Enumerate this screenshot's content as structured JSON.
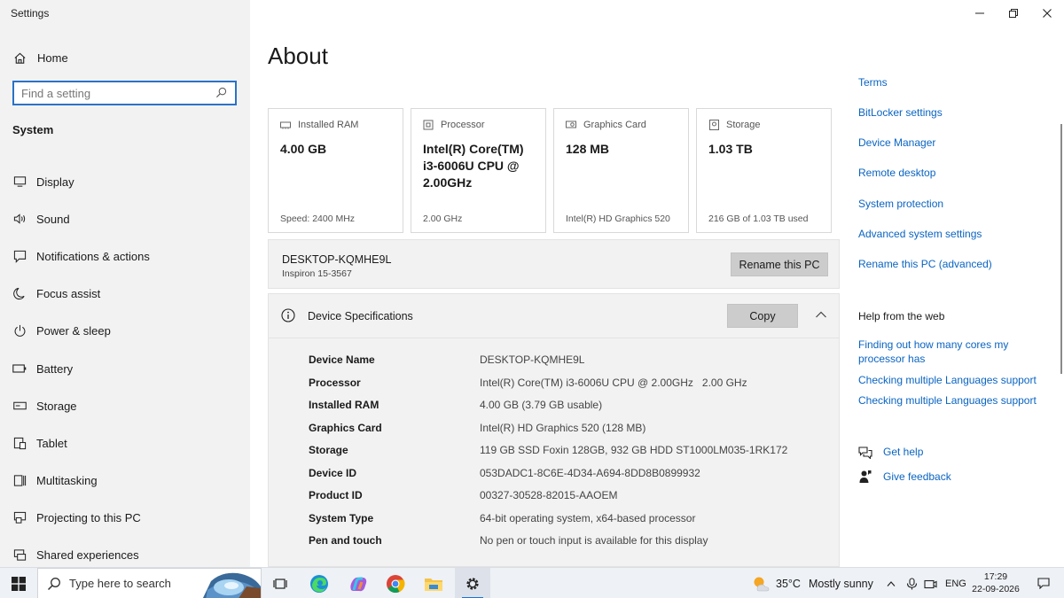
{
  "window": {
    "title": "Settings"
  },
  "sidebar": {
    "home_label": "Home",
    "search_placeholder": "Find a setting",
    "section_title": "System",
    "items": [
      {
        "label": "Display",
        "icon": "monitor-icon"
      },
      {
        "label": "Sound",
        "icon": "speaker-icon"
      },
      {
        "label": "Notifications & actions",
        "icon": "notification-icon"
      },
      {
        "label": "Focus assist",
        "icon": "moon-icon"
      },
      {
        "label": "Power & sleep",
        "icon": "power-icon"
      },
      {
        "label": "Battery",
        "icon": "battery-icon"
      },
      {
        "label": "Storage",
        "icon": "storage-icon"
      },
      {
        "label": "Tablet",
        "icon": "tablet-icon"
      },
      {
        "label": "Multitasking",
        "icon": "multitasking-icon"
      },
      {
        "label": "Projecting to this PC",
        "icon": "projector-icon"
      },
      {
        "label": "Shared experiences",
        "icon": "shared-icon"
      }
    ]
  },
  "main": {
    "title": "About",
    "cards": [
      {
        "label": "Installed RAM",
        "value": "4.00 GB",
        "footer": "Speed: 2400 MHz",
        "icon": "ram-icon"
      },
      {
        "label": "Processor",
        "value": "Intel(R) Core(TM) i3-6006U CPU @ 2.00GHz",
        "footer": "2.00 GHz",
        "icon": "processor-icon"
      },
      {
        "label": "Graphics Card",
        "value": "128 MB",
        "footer": "Intel(R) HD Graphics 520",
        "icon": "graphics-card-icon"
      },
      {
        "label": "Storage",
        "value": "1.03 TB",
        "footer": "216 GB of 1.03 TB used",
        "icon": "storage-icon"
      }
    ],
    "pc": {
      "name": "DESKTOP-KQMHE9L",
      "model": "Inspiron 15-3567",
      "rename_label": "Rename this PC"
    },
    "specs": {
      "title": "Device Specifications",
      "copy_label": "Copy",
      "rows": [
        {
          "key": "Device Name",
          "value": "DESKTOP-KQMHE9L"
        },
        {
          "key": "Processor",
          "value": "Intel(R) Core(TM) i3-6006U CPU @ 2.00GHz   2.00 GHz"
        },
        {
          "key": "Installed RAM",
          "value": "4.00 GB (3.79 GB usable)"
        },
        {
          "key": "Graphics Card",
          "value": "Intel(R) HD Graphics 520 (128 MB)"
        },
        {
          "key": "Storage",
          "value": "119 GB SSD Foxin 128GB, 932 GB HDD ST1000LM035-1RK172"
        },
        {
          "key": "Device ID",
          "value": "053DADC1-8C6E-4D34-A694-8DD8B0899932"
        },
        {
          "key": "Product ID",
          "value": "00327-30528-82015-AAOEM"
        },
        {
          "key": "System Type",
          "value": "64-bit operating system, x64-based processor"
        },
        {
          "key": "Pen and touch",
          "value": "No pen or touch input is available for this display"
        }
      ]
    }
  },
  "right": {
    "links": [
      "Terms",
      "BitLocker settings",
      "Device Manager",
      "Remote desktop",
      "System protection",
      "Advanced system settings",
      "Rename this PC (advanced)"
    ],
    "help_heading": "Help from the web",
    "web_links": [
      "Finding out how many cores my processor has",
      "Checking multiple Languages support",
      "Checking multiple Languages support"
    ],
    "get_help": "Get help",
    "give_feedback": "Give feedback"
  },
  "taskbar": {
    "search_placeholder": "Type here to search",
    "weather_temp": "35°C",
    "weather_condition": "Mostly sunny",
    "language": "ENG",
    "time": "17:29",
    "date": "22-09-2026"
  },
  "colors": {
    "link": "#0a64c2",
    "accent": "#1a73d9",
    "sidebar_bg": "#f2f2f2"
  }
}
